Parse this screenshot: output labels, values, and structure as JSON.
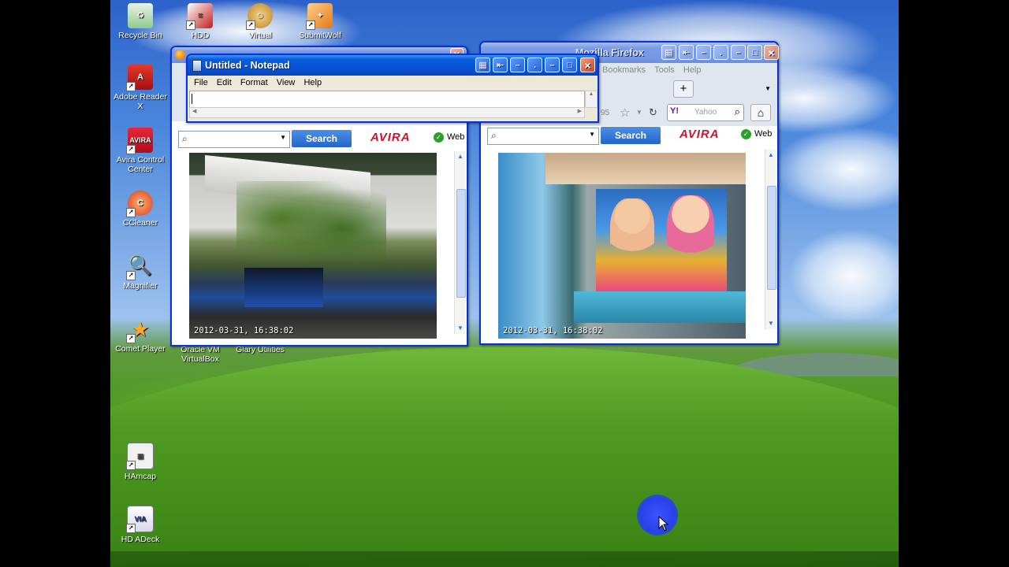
{
  "desktop": {
    "icons": [
      {
        "label": "Recycle Bin",
        "name": "recycle-bin"
      },
      {
        "label": "HDD",
        "name": "hdd"
      },
      {
        "label": "Virtual",
        "name": "virtual"
      },
      {
        "label": "SubmitWolf",
        "name": "submitwolf"
      },
      {
        "label": "Adobe Reader X",
        "name": "adobe-reader"
      },
      {
        "label": "Avira Control Center",
        "name": "avira-control-center"
      },
      {
        "label": "CCleaner",
        "name": "ccleaner"
      },
      {
        "label": "Magnifier",
        "name": "magnifier"
      },
      {
        "label": "Comet Player",
        "name": "comet-player"
      },
      {
        "label": "Oracle VM VirtualBox",
        "name": "virtualbox"
      },
      {
        "label": "Glary Utilities",
        "name": "glary-utilities"
      },
      {
        "label": "HAmcap",
        "name": "hamcap"
      },
      {
        "label": "HD ADeck",
        "name": "hd-adeck"
      }
    ]
  },
  "notepad": {
    "title": "Untitled - Notepad",
    "menu": [
      "File",
      "Edit",
      "Format",
      "View",
      "Help"
    ],
    "content": ""
  },
  "firefox_left": {
    "search_button": "Search",
    "avira_label": "AVIRA",
    "web_label": "Web",
    "camera_timestamp": "2012-03-31, 16:38:02"
  },
  "firefox_right": {
    "title": "Mozilla Firefox",
    "menu": [
      "Bookmarks",
      "Tools",
      "Help"
    ],
    "new_tab": "+",
    "url_fragment": "95",
    "search_engine_placeholder": "Yahoo",
    "search_button": "Search",
    "avira_label": "AVIRA",
    "web_label": "Web",
    "camera_timestamp": "2012-03-31, 16:38:02"
  },
  "colors": {
    "xp_title_active": "#0752d1",
    "avira_red": "#d3102b",
    "search_blue": "#2266cc"
  }
}
